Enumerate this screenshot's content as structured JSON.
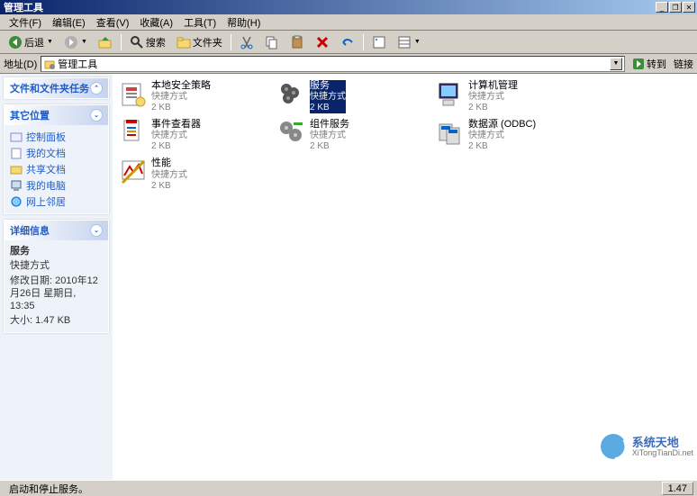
{
  "window": {
    "title": "管理工具"
  },
  "menu": {
    "file": "文件(F)",
    "edit": "编辑(E)",
    "view": "查看(V)",
    "favorites": "收藏(A)",
    "tools": "工具(T)",
    "help": "帮助(H)"
  },
  "toolbar": {
    "back": "后退",
    "search": "搜索",
    "folders": "文件夹"
  },
  "address": {
    "label": "地址(D)",
    "value": "管理工具",
    "go": "转到",
    "links": "链接"
  },
  "side": {
    "tasks": {
      "title": "文件和文件夹任务"
    },
    "other": {
      "title": "其它位置",
      "items": [
        "控制面板",
        "我的文档",
        "共享文档",
        "我的电脑",
        "网上邻居"
      ]
    },
    "details": {
      "title": "详细信息",
      "name": "服务",
      "type": "快捷方式",
      "modlabel": "修改日期:",
      "moddate": "2010年12月26日 星期日, 13:35",
      "sizelabel": "大小:",
      "size": "1.47 KB"
    }
  },
  "items": [
    {
      "name": "本地安全策略",
      "type": "快捷方式",
      "size": "2 KB"
    },
    {
      "name": "服务",
      "type": "快捷方式",
      "size": "2 KB",
      "selected": true
    },
    {
      "name": "计算机管理",
      "type": "快捷方式",
      "size": "2 KB"
    },
    {
      "name": "事件查看器",
      "type": "快捷方式",
      "size": "2 KB"
    },
    {
      "name": "组件服务",
      "type": "快捷方式",
      "size": "2 KB"
    },
    {
      "name": "数据源 (ODBC)",
      "type": "快捷方式",
      "size": "2 KB"
    },
    {
      "name": "性能",
      "type": "快捷方式",
      "size": "2 KB"
    }
  ],
  "status": {
    "text": "启动和停止服务。",
    "size": "1.47"
  },
  "watermark": {
    "brand": "系统天地",
    "url": "XiTongTianDi.net"
  }
}
